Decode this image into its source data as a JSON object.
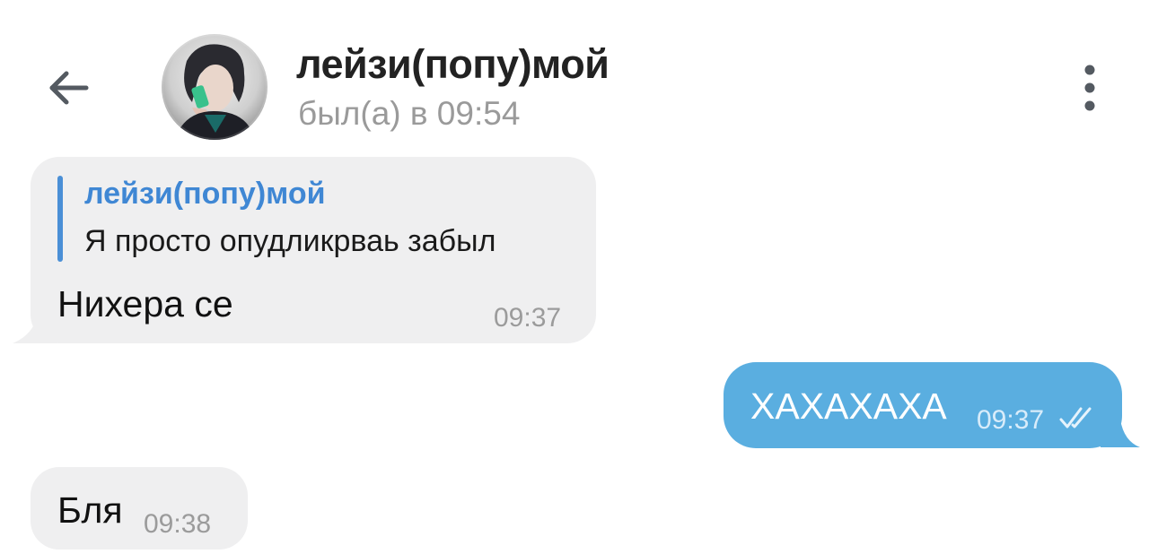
{
  "header": {
    "contact_name": "лейзи(попу)мой",
    "status": "был(а) в 09:54",
    "back_icon": "arrow-left-icon",
    "menu_icon": "more-vertical-icon",
    "avatar": "contact-avatar"
  },
  "messages": [
    {
      "direction": "incoming",
      "reply": {
        "author": "лейзи(попу)мой",
        "text": "Я просто опудликрваь забыл"
      },
      "text": "Нихера се",
      "time": "09:37"
    },
    {
      "direction": "outgoing",
      "text": "ХАХАХАХА",
      "time": "09:37",
      "status_icon": "double-check-icon"
    },
    {
      "direction": "incoming",
      "text": "Бля",
      "time": "09:38"
    }
  ],
  "colors": {
    "incoming_bubble": "#efeff0",
    "outgoing_bubble": "#5aaee0",
    "reply_accent": "#3f87d4",
    "muted_text": "#9a9a9a"
  }
}
